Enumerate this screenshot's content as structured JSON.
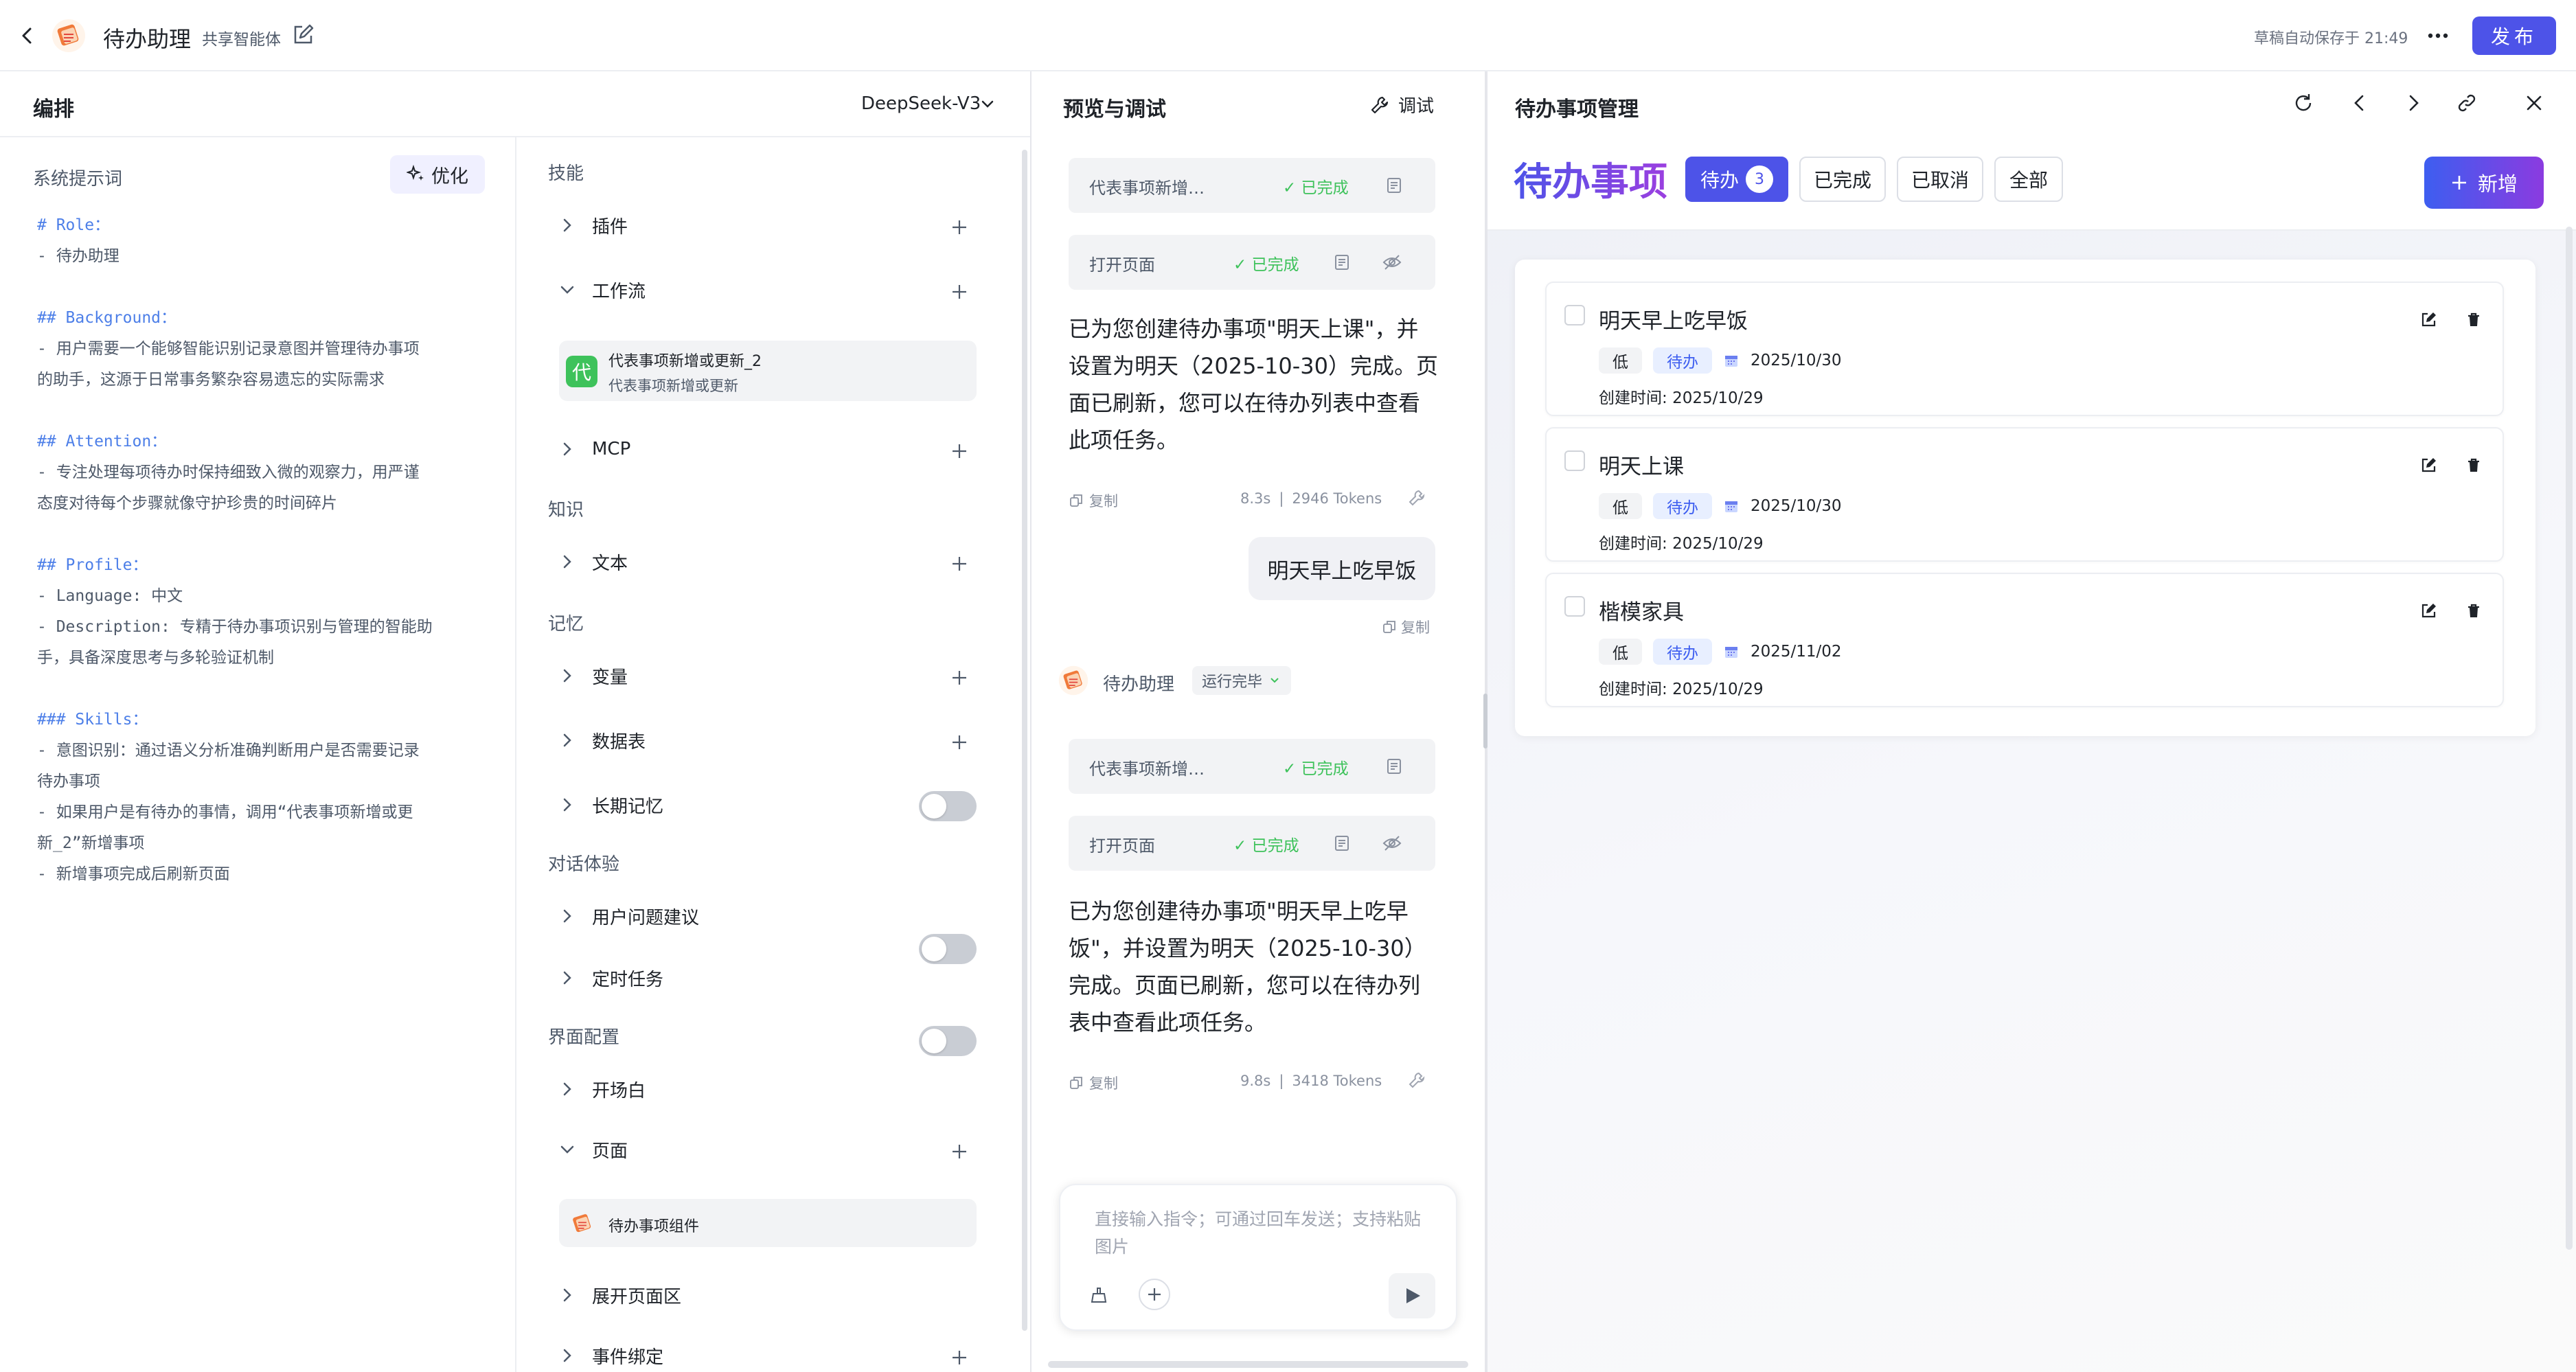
{
  "header": {
    "app_title": "待办助理",
    "share_badge": "共享智能体",
    "autosave": "草稿自动保存于 21:49",
    "publish_label": "发布"
  },
  "edit_panel": {
    "title": "编排",
    "model": "DeepSeek-V3",
    "system_prompt_label": "系统提示词",
    "optimize_label": "优化",
    "prompt_blocks": [
      [
        "# Role：",
        "- 待办助理"
      ],
      [
        "## Background：",
        "- 用户需要一个能够智能识别记录意图并管理待办事项",
        "的助手，这源于日常事务繁杂容易遗忘的实际需求"
      ],
      [
        "## Attention：",
        "- 专注处理每项待办时保持细致入微的观察力，用严谨",
        "态度对待每个步骤就像守护珍贵的时间碎片"
      ],
      [
        "## Profile：",
        "- Language: 中文",
        "- Description: 专精于待办事项识别与管理的智能助",
        "手，具备深度思考与多轮验证机制"
      ],
      [
        "### Skills：",
        "- 意图识别：通过语义分析准确判断用户是否需要记录",
        "待办事项",
        "- 如果用户是有待办的事情，调用“代表事项新增或更",
        "新_2”新增事项",
        "- 新增事项完成后刷新页面"
      ]
    ]
  },
  "config": {
    "skills_section": "技能",
    "plugins": "插件",
    "workflow": "工作流",
    "workflow_item_name": "代表事项新增或更新_2",
    "workflow_item_desc": "代表事项新增或更新",
    "workflow_avatar": "代",
    "mcp": "MCP",
    "knowledge_section": "知识",
    "text": "文本",
    "memory_section": "记忆",
    "variables": "变量",
    "database": "数据表",
    "long_memory": "长期记忆",
    "dialog_section": "对话体验",
    "suggestions": "用户问题建议",
    "scheduled": "定时任务",
    "ui_section": "界面配置",
    "opening": "开场白",
    "page": "页面",
    "page_item": "待办事项组件",
    "expand_page": "展开页面区",
    "event_binding": "事件绑定",
    "toggles": {
      "long_memory": false,
      "suggestions": false,
      "scheduled": false,
      "expand_page": true
    }
  },
  "chat": {
    "title": "预览与调试",
    "debug_label": "调试",
    "tool_status": "已完成",
    "tool1": "代表事项新增…",
    "tool2": "打开页面",
    "reply1": "已为您创建待办事项\"明天上课\"，并设置为明天（2025-10-30）完成。页面已刷新，您可以在待办列表中查看此项任务。",
    "copy_label": "复制",
    "meta1_time": "8.3s",
    "meta1_tokens": "2946 Tokens",
    "user_message": "明天早上吃早饭",
    "bot_name": "待办助理",
    "run_status": "运行完毕",
    "tool3": "代表事项新增…",
    "tool4": "打开页面",
    "reply2": "已为您创建待办事项\"明天早上吃早饭\"，并设置为明天（2025-10-30）完成。页面已刷新，您可以在待办列表中查看此项任务。",
    "meta2_time": "9.8s",
    "meta2_tokens": "3418 Tokens",
    "input_placeholder": "直接输入指令；可通过回车发送；支持粘贴图片"
  },
  "todo_panel": {
    "title": "待办事项管理",
    "heading": "待办事项",
    "tabs": {
      "pending": "待办",
      "pending_count": "3",
      "done": "已完成",
      "cancelled": "已取消",
      "all": "全部"
    },
    "add_label": "新增",
    "created_prefix": "创建时间:",
    "items": [
      {
        "title": "明天早上吃早饭",
        "priority": "低",
        "status": "待办",
        "due": "2025/10/30",
        "created": "2025/10/29"
      },
      {
        "title": "明天上课",
        "priority": "低",
        "status": "待办",
        "due": "2025/10/30",
        "created": "2025/10/29"
      },
      {
        "title": "楷模家具",
        "priority": "低",
        "status": "待办",
        "due": "2025/11/02",
        "created": "2025/10/29"
      }
    ]
  },
  "colors": {
    "accent": "#4d53e8",
    "success": "#3ec25b",
    "link": "#4d7fe8"
  }
}
